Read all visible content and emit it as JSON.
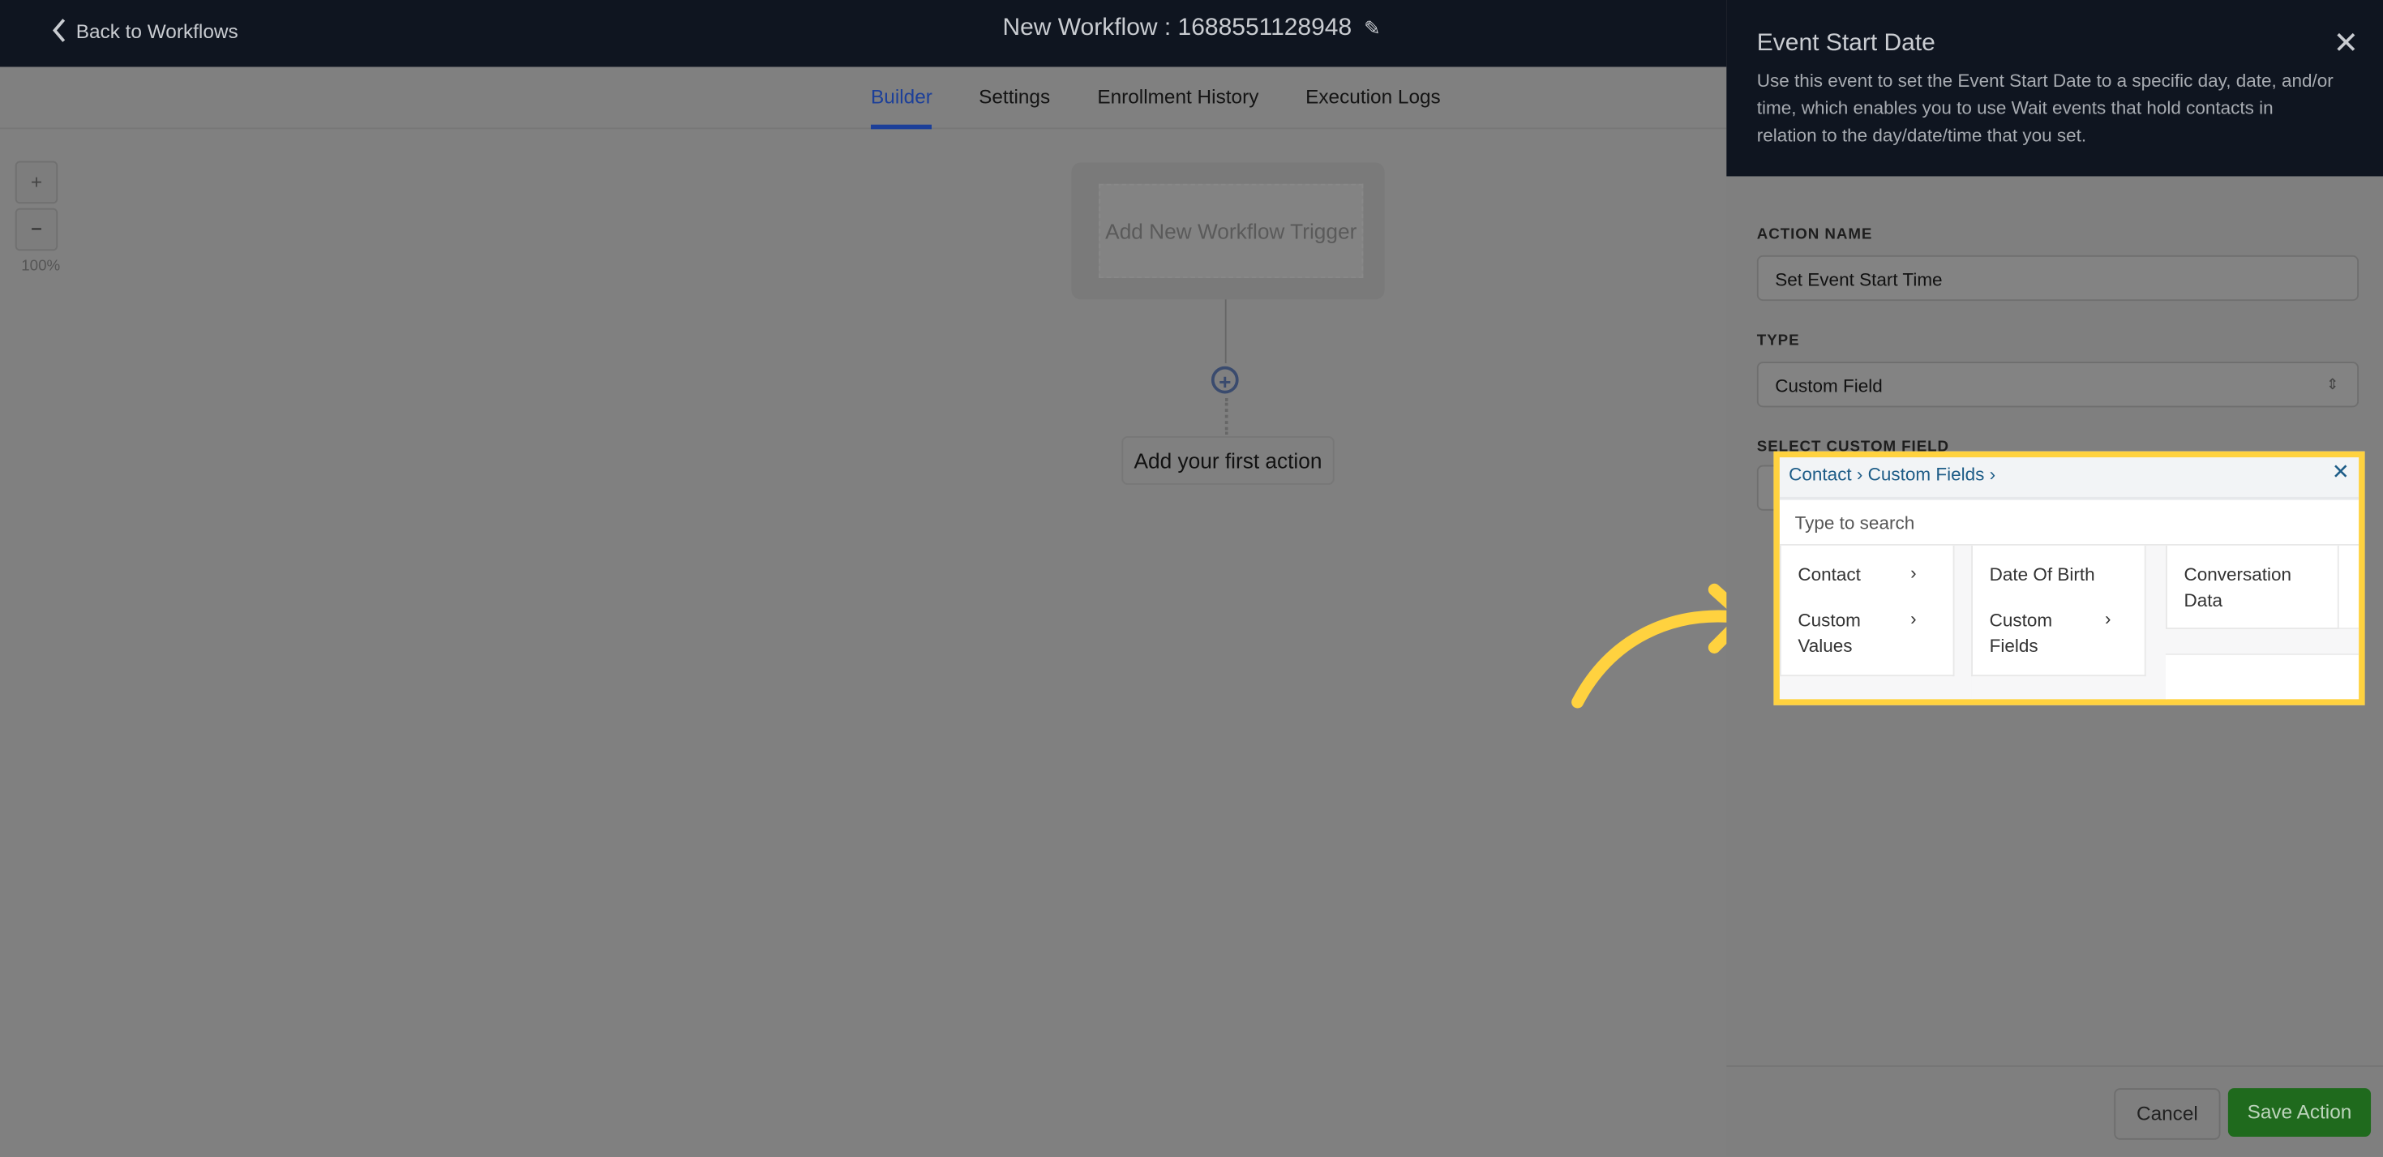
{
  "header": {
    "back_label": "Back to Workflows",
    "title": "New Workflow : 1688551128948"
  },
  "tabs": [
    {
      "label": "Builder",
      "active": true
    },
    {
      "label": "Settings"
    },
    {
      "label": "Enrollment History"
    },
    {
      "label": "Execution Logs"
    }
  ],
  "canvas": {
    "zoom_in": "+",
    "zoom_out": "−",
    "zoom_level": "100%",
    "trigger_label": "Add New Workflow Trigger",
    "plus": "+",
    "first_action": "Add your first action"
  },
  "panel": {
    "title": "Event Start Date",
    "close": "✕",
    "description": "Use this event to set the Event Start Date to a specific day, date, and/or time, which enables you to use Wait events that hold contacts in relation to the day/date/time that you set.",
    "action_name_label": "ACTION NAME",
    "action_name_value": "Set Event Start Time",
    "type_label": "TYPE",
    "type_value": "Custom Field",
    "custom_field_label": "SELECT CUSTOM FIELD",
    "cancel": "Cancel",
    "save": "Save Action"
  },
  "dropdown": {
    "breadcrumb": "Contact › Custom Fields ›",
    "close": "✕",
    "search_placeholder": "Type to search",
    "col1": [
      {
        "label": "Contact",
        "has_children": true
      },
      {
        "label": "Custom Values",
        "has_children": true
      }
    ],
    "col2": [
      {
        "label": "Date Of Birth",
        "has_children": false
      },
      {
        "label": "Custom Fields",
        "has_children": true
      }
    ],
    "col3": [
      {
        "label": "Conversation Data",
        "has_children": false
      }
    ]
  },
  "colors": {
    "highlight": "#ffd23f",
    "header_bg": "#0f1520",
    "save_button": "#1f6a1d",
    "active_tab": "#1c3f99"
  }
}
